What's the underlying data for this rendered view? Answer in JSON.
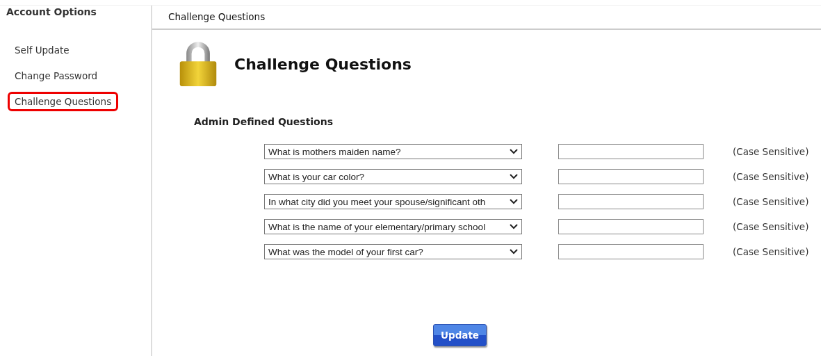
{
  "sidebar": {
    "title": "Account Options",
    "items": [
      {
        "label": "Self Update",
        "selected": false
      },
      {
        "label": "Change Password",
        "selected": false
      },
      {
        "label": "Challenge Questions",
        "selected": true
      }
    ]
  },
  "header": {
    "title": "Challenge Questions"
  },
  "page": {
    "heading": "Challenge Questions",
    "section": "Admin Defined Questions",
    "questions": [
      {
        "question": "What is mothers maiden name?",
        "note": "(Case Sensitive)"
      },
      {
        "question": "What is your car color?",
        "note": "(Case Sensitive)"
      },
      {
        "question": "In what city did you meet your spouse/significant oth",
        "note": "(Case Sensitive)"
      },
      {
        "question": "What is the name of your elementary/primary school",
        "note": "(Case Sensitive)"
      },
      {
        "question": "What was the model of your first car?",
        "note": "(Case Sensitive)"
      }
    ],
    "button": "Update"
  }
}
